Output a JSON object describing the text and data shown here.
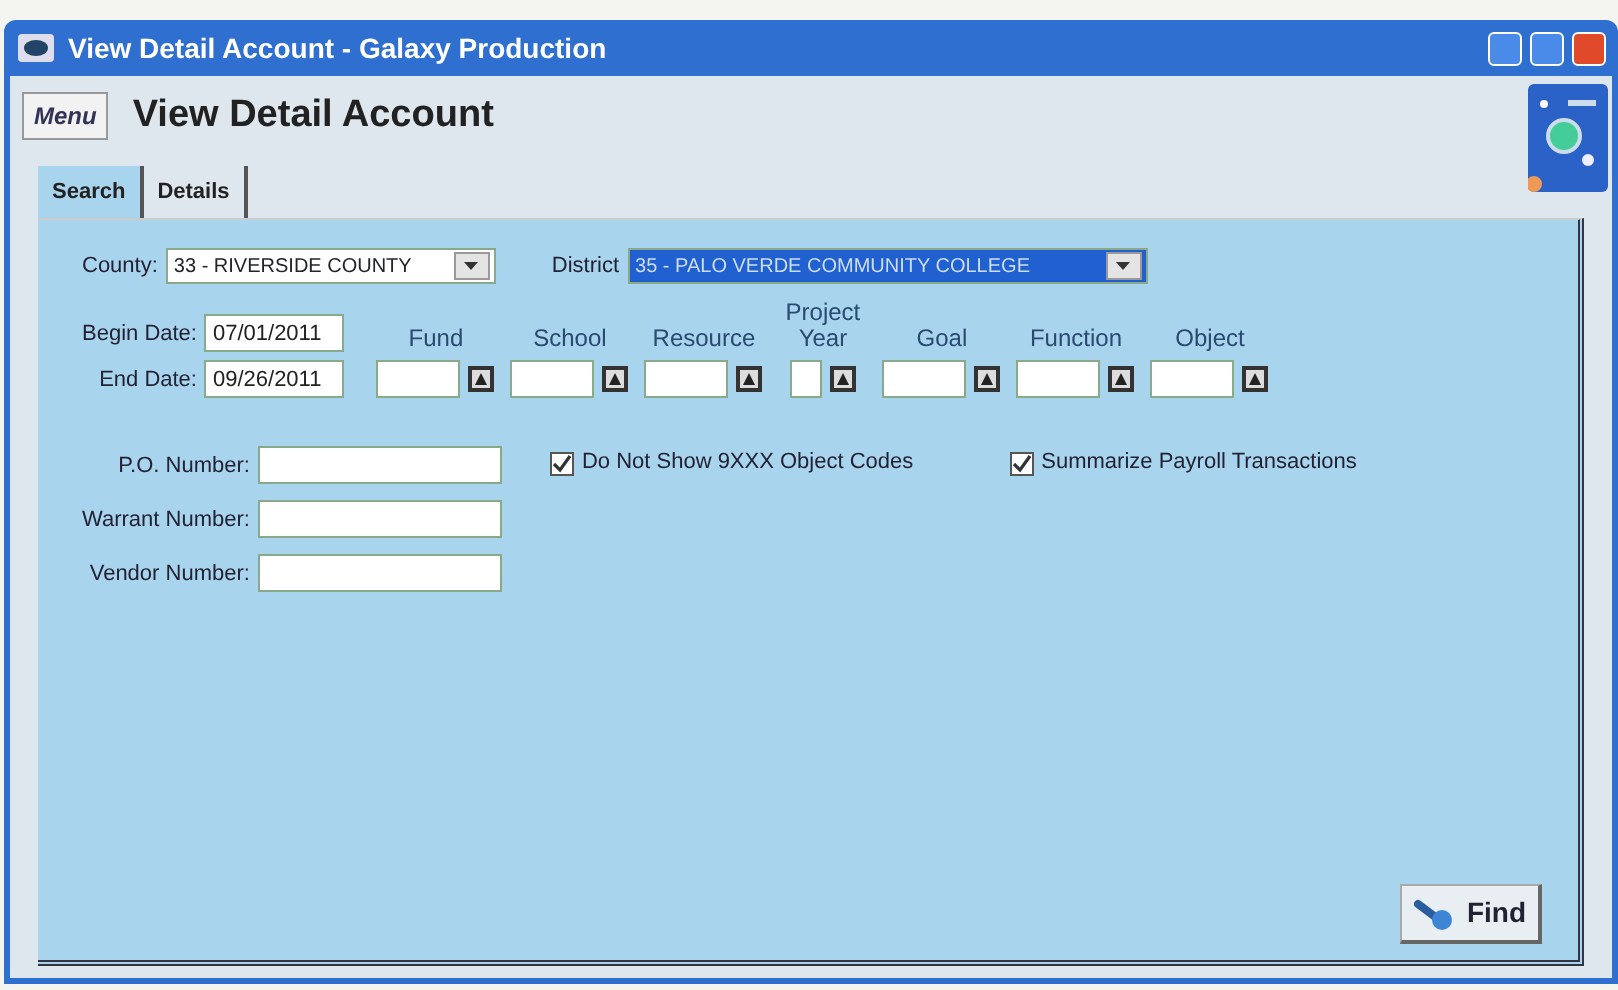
{
  "window": {
    "title": "View Detail Account - Galaxy Production"
  },
  "header": {
    "menu_button": "Menu",
    "title": "View Detail Account"
  },
  "tabs": [
    {
      "label": "Search",
      "selected": true
    },
    {
      "label": "Details",
      "selected": false
    }
  ],
  "county": {
    "label": "County:",
    "value": "33 - RIVERSIDE COUNTY"
  },
  "district": {
    "label": "District",
    "value": "35 - PALO VERDE COMMUNITY COLLEGE"
  },
  "dates": [
    {
      "label": "Begin Date:",
      "value": "07/01/2011"
    },
    {
      "label": "End Date:",
      "value": "09/26/2011"
    }
  ],
  "lookups": [
    {
      "label": "Fund",
      "kind": "wide"
    },
    {
      "label": "School",
      "kind": "wide"
    },
    {
      "label": "Resource",
      "kind": "wide"
    },
    {
      "label": "Project Year",
      "kind": "narrow"
    },
    {
      "label": "Goal",
      "kind": "wide"
    },
    {
      "label": "Function",
      "kind": "wide"
    },
    {
      "label": "Object",
      "kind": "wide"
    }
  ],
  "numbers": [
    {
      "label": "P.O. Number:"
    },
    {
      "label": "Warrant Number:"
    },
    {
      "label": "Vendor Number:"
    }
  ],
  "options": [
    {
      "label": "Do Not Show 9XXX Object Codes",
      "checked": true
    },
    {
      "label": "Summarize Payroll Transactions",
      "checked": true
    }
  ],
  "find_button": "Find"
}
